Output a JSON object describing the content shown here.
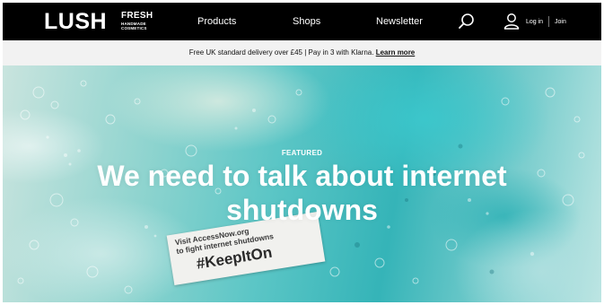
{
  "header": {
    "logo": {
      "word": "LUSH",
      "fresh": "FRESH",
      "line1": "HANDMADE",
      "line2": "COSMETICS"
    },
    "nav": {
      "products": "Products",
      "shops": "Shops",
      "newsletter": "Newsletter"
    },
    "login_label": "Log in",
    "join_label": "Join",
    "icons": {
      "search": "search-icon",
      "account": "user-icon"
    }
  },
  "promo": {
    "text": "Free UK standard delivery over £45 | Pay in 3 with Klarna.",
    "link": "Learn more"
  },
  "hero": {
    "eyebrow": "FEATURED",
    "title": "We need to talk about internet shutdowns",
    "note": {
      "line1": "Visit AccessNow.org",
      "line2": "to fight internet shutdowns",
      "hashtag": "#KeepItOn"
    }
  },
  "colors": {
    "header_bg": "#000000",
    "promo_bg": "#f2f2f2",
    "hero_teal": "#35b4b8"
  }
}
